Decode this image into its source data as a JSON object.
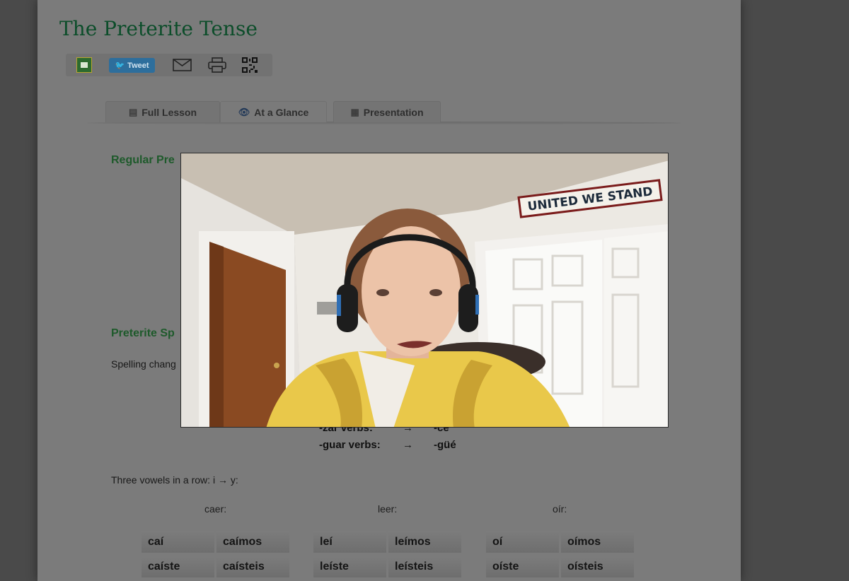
{
  "page": {
    "title": "The Preterite Tense"
  },
  "share_bar": {
    "tweet_label": "Tweet",
    "icons": [
      "google-classroom-icon",
      "twitter-bird-icon",
      "email-icon",
      "printer-icon",
      "qr-code-icon"
    ]
  },
  "tabs": [
    {
      "label": "Full Lesson",
      "icon": "book-icon"
    },
    {
      "label": "At a Glance",
      "icon": "eye-icon"
    },
    {
      "label": "Presentation",
      "icon": "presentation-icon"
    }
  ],
  "sections": {
    "regular_heading": "Regular Pre",
    "spelling_heading": "Preterite Sp",
    "spelling_text": "Spelling chang",
    "rules": [
      {
        "verb": "-zar verbs:",
        "arrow": "→",
        "ending": "-ce"
      },
      {
        "verb": "-guar verbs:",
        "arrow": "→",
        "ending": "-güé"
      }
    ],
    "vowels_text": "Three vowels in a row: i → y:"
  },
  "conjugations": [
    {
      "verb": "caer:",
      "forms": [
        "caí",
        "caímos",
        "caíste",
        "caísteis"
      ]
    },
    {
      "verb": "leer:",
      "forms": [
        "leí",
        "leímos",
        "leíste",
        "leísteis"
      ]
    },
    {
      "verb": "oír:",
      "forms": [
        "oí",
        "oímos",
        "oíste",
        "oísteis"
      ]
    }
  ],
  "webcam": {
    "sign_text": "UNITED WE STAND"
  },
  "colors": {
    "title_green": "#0c4d2a",
    "heading_green": "#1e5a2b",
    "dimmed_page": "#7b7b7b"
  }
}
